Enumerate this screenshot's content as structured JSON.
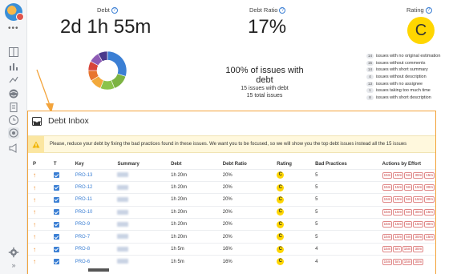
{
  "sidebar": {
    "dots": "•••",
    "items": [
      {
        "name": "board-icon"
      },
      {
        "name": "reports-icon"
      },
      {
        "name": "timeline-icon"
      },
      {
        "name": "globe-icon"
      },
      {
        "name": "document-icon"
      },
      {
        "name": "clock-icon"
      },
      {
        "name": "target-icon",
        "active": true
      },
      {
        "name": "megaphone-icon"
      }
    ],
    "bottom": [
      {
        "name": "settings-icon"
      },
      {
        "name": "expand-icon",
        "label": "»"
      }
    ]
  },
  "metrics": {
    "debt_label": "Debt",
    "debt_value": "2d 1h 55m",
    "ratio_label": "Debt Ratio",
    "ratio_value": "17%",
    "rating_label": "Rating",
    "rating_value": "C"
  },
  "summary": {
    "pct": "100%",
    "pct_text": "of issues with debt",
    "with_debt": "15 issues with debt",
    "total": "15 total issues"
  },
  "stats": [
    {
      "count": "14",
      "text": "issues with no original estimation"
    },
    {
      "count": "15",
      "text": "issues without comments"
    },
    {
      "count": "14",
      "text": "issues with short summary"
    },
    {
      "count": "4",
      "text": "issues without description"
    },
    {
      "count": "13",
      "text": "issues with no assignee"
    },
    {
      "count": "1",
      "text": "issues taking too much time"
    },
    {
      "count": "8",
      "text": "issues with short description"
    }
  ],
  "donut": [
    {
      "value": 30,
      "color": "#3b7fd4"
    },
    {
      "value": 14,
      "color": "#7cb342"
    },
    {
      "value": 12,
      "color": "#8bc34a"
    },
    {
      "value": 10,
      "color": "#f2a93b"
    },
    {
      "value": 9,
      "color": "#e8752e"
    },
    {
      "value": 8,
      "color": "#d8453b"
    },
    {
      "value": 9,
      "color": "#8e5bb5"
    },
    {
      "value": 8,
      "color": "#4a3a8c"
    }
  ],
  "inbox": {
    "title": "Debt Inbox",
    "alert": "Please, reduce your debt by fixing the bad practices found in these issues. We want you to be focused, so we will show you the top debt issues instead all the 15 issues",
    "columns": [
      "P",
      "T",
      "Key",
      "Summary",
      "Debt",
      "Debt Ratio",
      "Rating",
      "Bad Practices",
      "Actions by Effort"
    ],
    "rows": [
      {
        "key": "PRO-13",
        "debt": "1h 20m",
        "ratio": "20%",
        "rating": "C",
        "bad": "5",
        "actions": [
          "15m",
          "15m",
          "5m",
          "30m",
          "15m"
        ]
      },
      {
        "key": "PRO-12",
        "debt": "1h 20m",
        "ratio": "20%",
        "rating": "C",
        "bad": "5",
        "actions": [
          "15m",
          "15m",
          "5m",
          "15m",
          "30m"
        ]
      },
      {
        "key": "PRO-11",
        "debt": "1h 20m",
        "ratio": "20%",
        "rating": "C",
        "bad": "5",
        "actions": [
          "15m",
          "15m",
          "5m",
          "15m",
          "30m"
        ]
      },
      {
        "key": "PRO-10",
        "debt": "1h 20m",
        "ratio": "20%",
        "rating": "C",
        "bad": "5",
        "actions": [
          "15m",
          "15m",
          "5m",
          "30m",
          "15m"
        ]
      },
      {
        "key": "PRO-9",
        "debt": "1h 20m",
        "ratio": "20%",
        "rating": "C",
        "bad": "5",
        "actions": [
          "15m",
          "15m",
          "5m",
          "15m",
          "30m"
        ]
      },
      {
        "key": "PRO-7",
        "debt": "1h 20m",
        "ratio": "20%",
        "rating": "C",
        "bad": "5",
        "actions": [
          "15m",
          "15m",
          "5m",
          "30m",
          "15m"
        ]
      },
      {
        "key": "PRO-8",
        "debt": "1h 5m",
        "ratio": "16%",
        "rating": "C",
        "bad": "4",
        "actions": [
          "15m",
          "5m",
          "15m",
          "30m"
        ]
      },
      {
        "key": "PRO-6",
        "debt": "1h 5m",
        "ratio": "16%",
        "rating": "C",
        "bad": "4",
        "actions": [
          "15m",
          "5m",
          "15m",
          "30m"
        ]
      }
    ]
  }
}
